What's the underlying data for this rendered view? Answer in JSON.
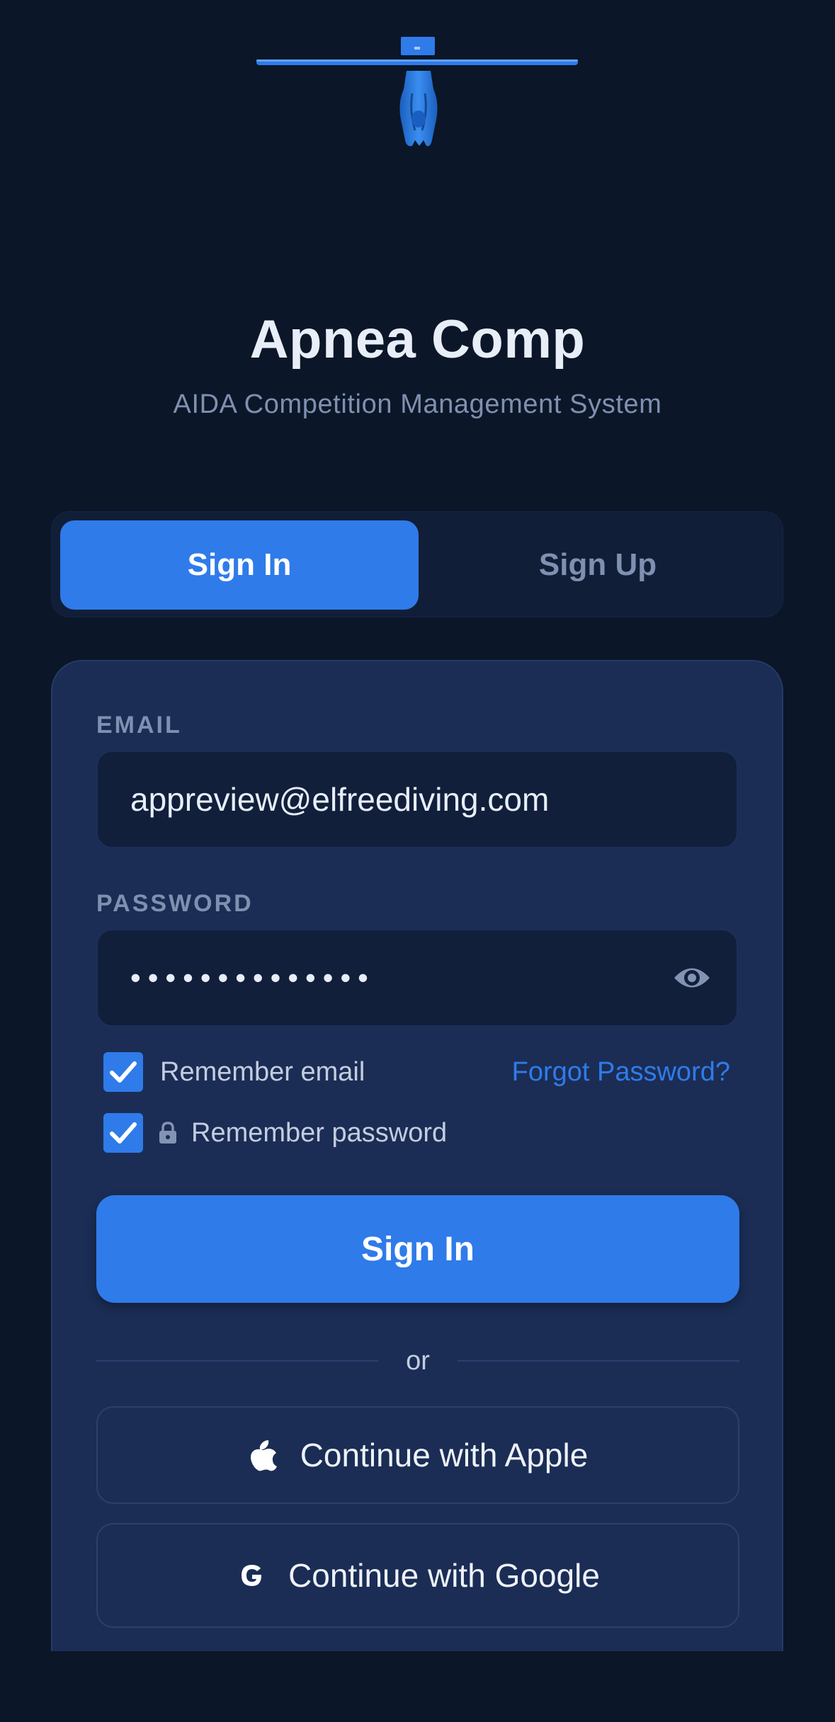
{
  "app": {
    "title": "Apnea Comp",
    "subtitle": "AIDA Competition Management System"
  },
  "tabs": [
    {
      "label": "Sign In",
      "active": true
    },
    {
      "label": "Sign Up",
      "active": false
    }
  ],
  "form": {
    "email_label": "EMAIL",
    "email_value": "appreview@elfreediving.com",
    "password_label": "PASSWORD",
    "password_mask": "••••••••••••••",
    "remember_email_label": "Remember email",
    "remember_email_checked": true,
    "remember_password_label": "Remember password",
    "remember_password_checked": true,
    "forgot_label": "Forgot Password?",
    "submit_label": "Sign In",
    "divider_label": "or"
  },
  "social": {
    "apple_label": "Continue with Apple",
    "google_label": "Continue with Google"
  },
  "icons": {
    "logo": "freediver-hanging-from-bar-icon",
    "eye": "eye-icon",
    "check": "checkmark-icon",
    "lock": "lock-icon",
    "apple": "apple-icon",
    "google": "google-g-icon"
  },
  "colors": {
    "background": "#0b1628",
    "card": "#1b2d55",
    "accent": "#2f7bea",
    "muted_text": "#7f90b0"
  }
}
